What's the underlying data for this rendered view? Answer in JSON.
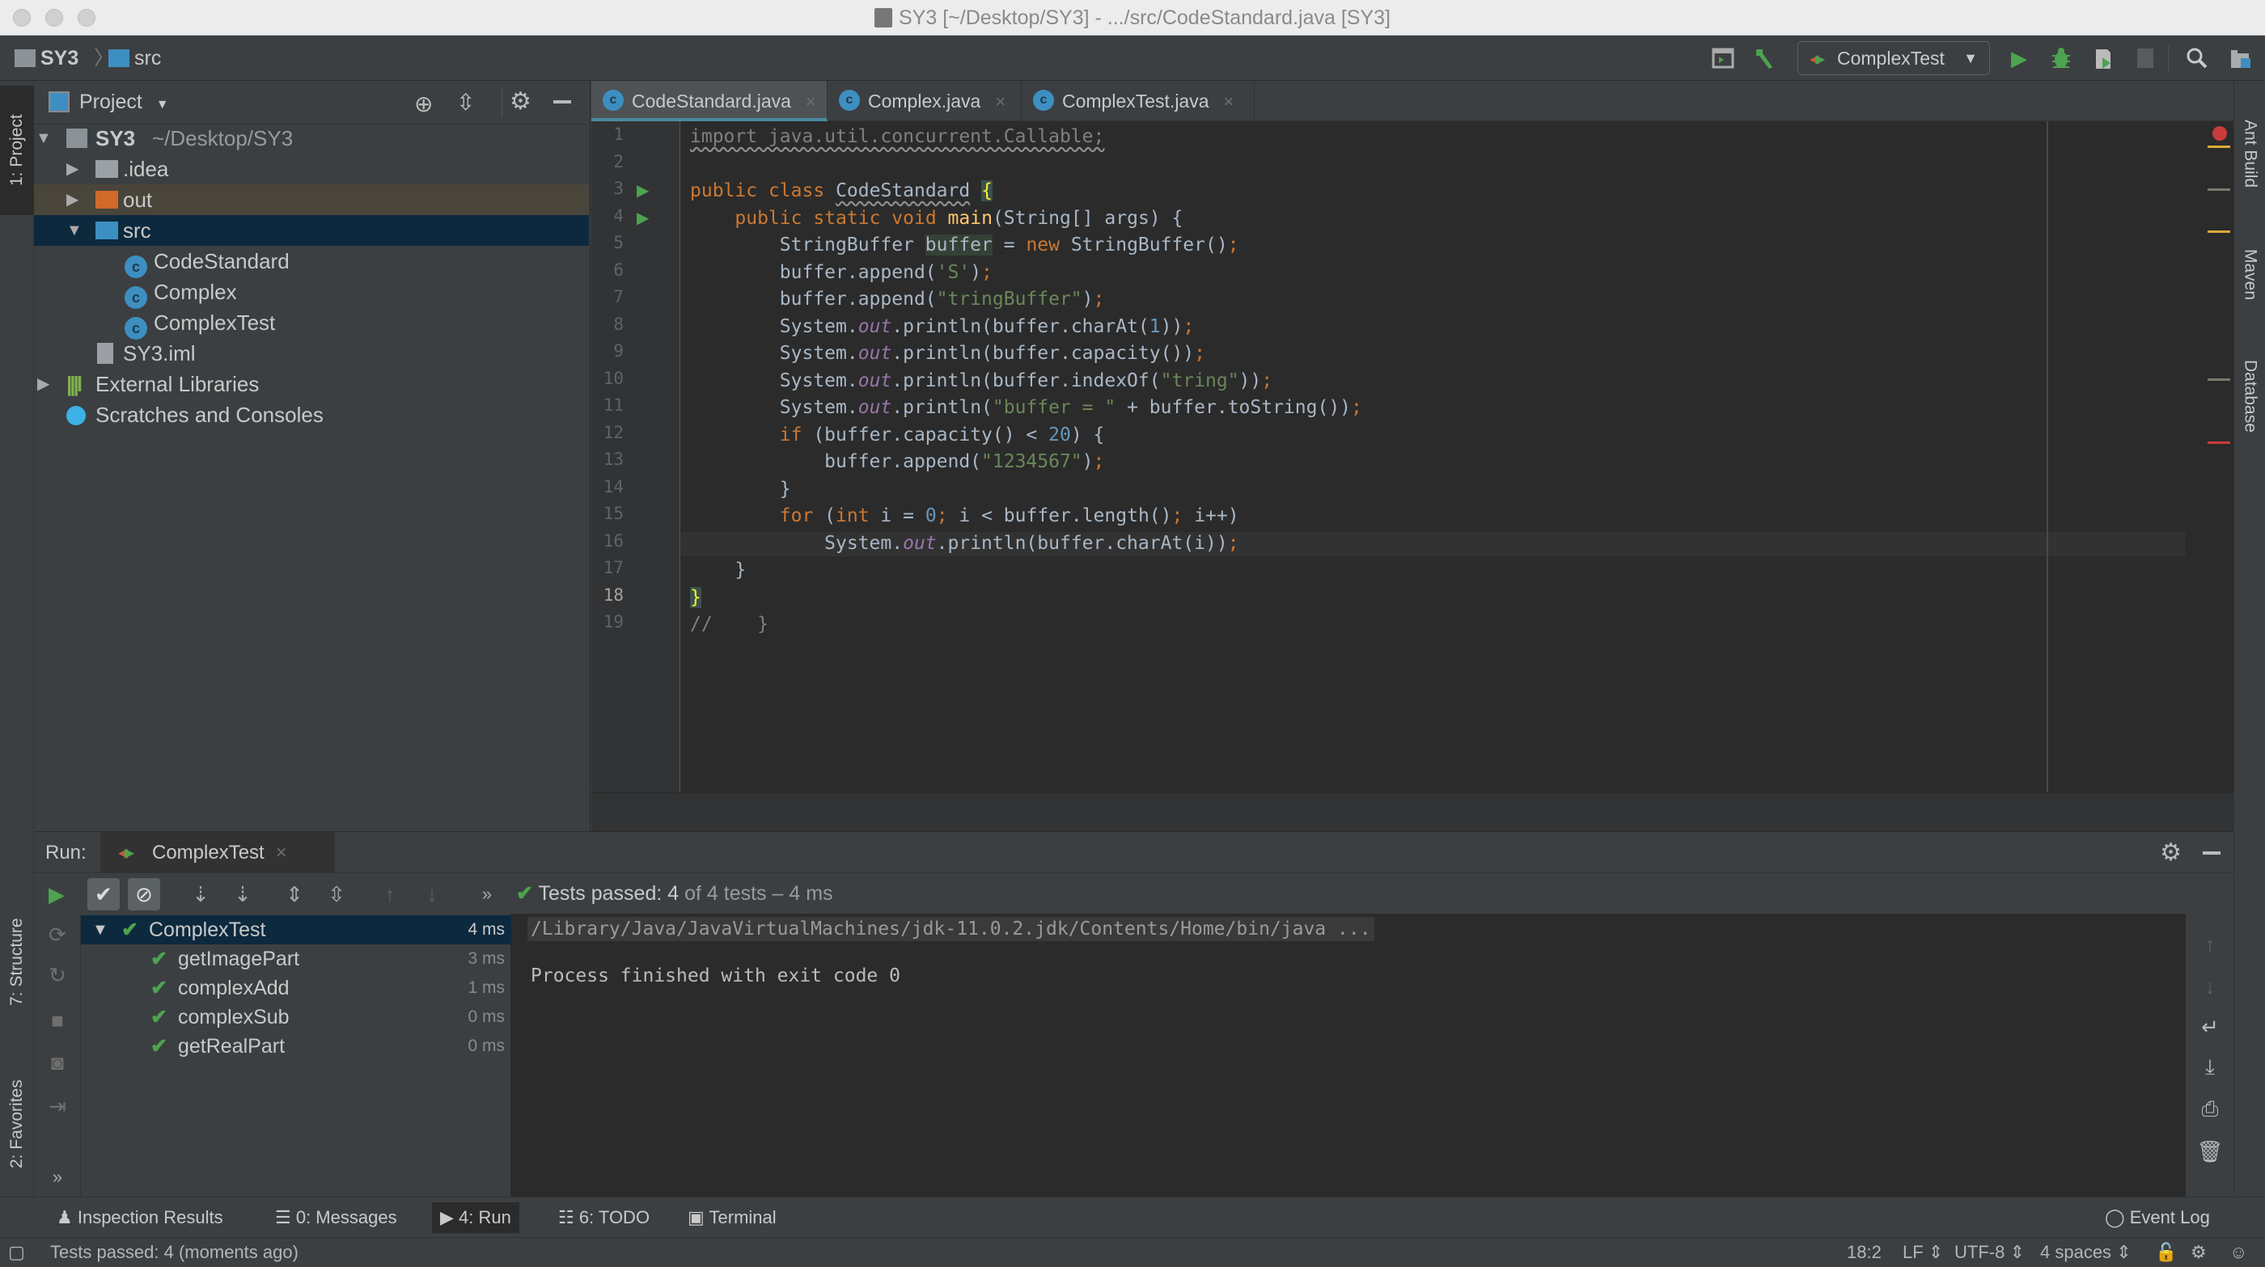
{
  "window": {
    "title": "SY3 [~/Desktop/SY3] - .../src/CodeStandard.java [SY3]"
  },
  "navbar": {
    "breadcrumb": [
      "SY3",
      "src"
    ],
    "run_config": "ComplexTest",
    "icons": [
      "run-window-icon",
      "build-hammer-icon",
      "run-icon",
      "debug-icon",
      "coverage-icon",
      "stop-icon",
      "search-icon",
      "project-structure-icon"
    ]
  },
  "left_stripe": {
    "project_tab": "1: Project",
    "structure_tab": "7: Structure",
    "favorites_tab": "2: Favorites"
  },
  "right_stripe": {
    "tabs": [
      "Ant Build",
      "Maven",
      "Database"
    ]
  },
  "project_panel": {
    "title": "Project",
    "tree": [
      {
        "label": "SY3",
        "hint": "~/Desktop/SY3",
        "type": "module",
        "expanded": true
      },
      {
        "label": ".idea",
        "type": "folder"
      },
      {
        "label": "out",
        "type": "folder-excluded"
      },
      {
        "label": "src",
        "type": "folder-source",
        "expanded": true,
        "selected": true
      },
      {
        "label": "CodeStandard",
        "type": "class-runnable"
      },
      {
        "label": "Complex",
        "type": "class"
      },
      {
        "label": "ComplexTest",
        "type": "class-test"
      },
      {
        "label": "SY3.iml",
        "type": "file"
      },
      {
        "label": "External Libraries",
        "type": "libraries"
      },
      {
        "label": "Scratches and Consoles",
        "type": "scratches"
      }
    ]
  },
  "editor": {
    "tabs": [
      {
        "label": "CodeStandard.java",
        "active": true
      },
      {
        "label": "Complex.java",
        "active": false
      },
      {
        "label": "ComplexTest.java",
        "active": false
      }
    ],
    "line_numbers": [
      "1",
      "2",
      "3",
      "4",
      "5",
      "6",
      "7",
      "8",
      "9",
      "10",
      "11",
      "12",
      "13",
      "14",
      "15",
      "16",
      "17",
      "18",
      "19"
    ],
    "lines": [
      "import java.util.concurrent.Callable;",
      "",
      "public class CodeStandard {",
      "    public static void main(String[] args) {",
      "        StringBuffer buffer = new StringBuffer();",
      "        buffer.append('S');",
      "        buffer.append(\"tringBuffer\");",
      "        System.out.println(buffer.charAt(1));",
      "        System.out.println(buffer.capacity());",
      "        System.out.println(buffer.indexOf(\"tring\"));",
      "        System.out.println(\"buffer = \" + buffer.toString());",
      "        if (buffer.capacity() < 20) {",
      "            buffer.append(\"1234567\");",
      "        }",
      "        for (int i = 0; i < buffer.length(); i++)",
      "            System.out.println(buffer.charAt(i));",
      "    }",
      "}",
      "//    }"
    ],
    "current_line": 18
  },
  "run_panel": {
    "label": "Run:",
    "tab": "ComplexTest",
    "status": {
      "prefix": "Tests passed: ",
      "passed": "4",
      "of": " of 4 tests",
      "time": " – 4 ms"
    },
    "tests": [
      {
        "name": "ComplexTest",
        "time": "4 ms",
        "root": true
      },
      {
        "name": "getImagePart",
        "time": "3 ms"
      },
      {
        "name": "complexAdd",
        "time": "1 ms"
      },
      {
        "name": "complexSub",
        "time": "0 ms"
      },
      {
        "name": "getRealPart",
        "time": "0 ms"
      }
    ],
    "console": [
      "/Library/Java/JavaVirtualMachines/jdk-11.0.2.jdk/Contents/Home/bin/java ...",
      "Process finished with exit code 0"
    ]
  },
  "tool_windows": [
    {
      "label": "Inspection Results"
    },
    {
      "label": "0: Messages"
    },
    {
      "label": "4: Run",
      "active": true
    },
    {
      "label": "6: TODO"
    },
    {
      "label": "Terminal"
    }
  ],
  "event_log": "Event Log",
  "status_bar": {
    "message": "Tests passed: 4 (moments ago)",
    "position": "18:2",
    "line_sep": "LF",
    "encoding": "UTF-8",
    "indent": "4 spaces"
  },
  "colors": {
    "accent": "#4a88a0",
    "selection": "#0d293e",
    "pass": "#4da34f",
    "keyword": "#cc7832",
    "string": "#6a8759"
  }
}
